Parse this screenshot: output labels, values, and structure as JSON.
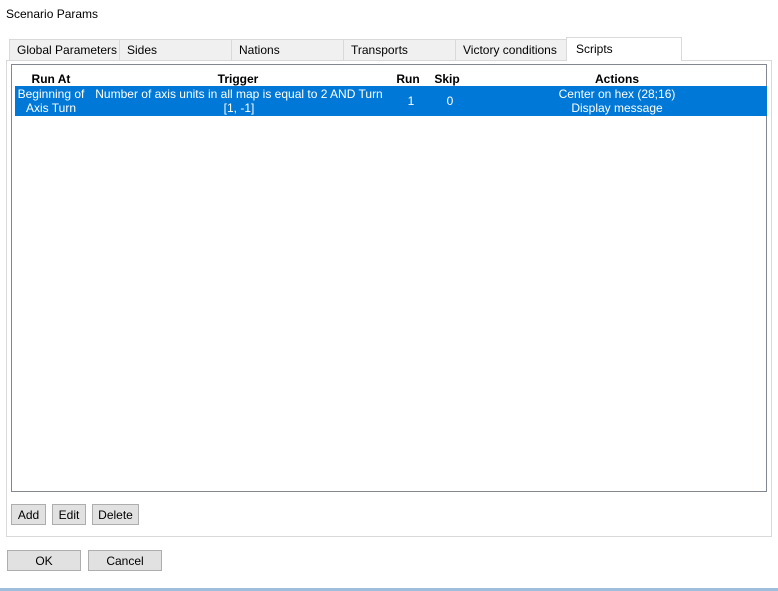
{
  "window": {
    "title": "Scenario Params"
  },
  "tabs": [
    {
      "label": "Global Parameters"
    },
    {
      "label": "Sides"
    },
    {
      "label": "Nations"
    },
    {
      "label": "Transports"
    },
    {
      "label": "Victory conditions"
    },
    {
      "label": "Scripts",
      "active": true
    }
  ],
  "table": {
    "columns": [
      "Run At",
      "Trigger",
      "Run",
      "Skip",
      "Actions"
    ],
    "rows": [
      {
        "run_at": [
          "Beginning of",
          "Axis Turn"
        ],
        "trigger": [
          "Number of axis units in all map is equal to 2 AND Turn",
          "[1, -1]"
        ],
        "run": "1",
        "skip": "0",
        "actions": [
          "Center on hex (28;16)",
          "Display message"
        ],
        "selected": true
      }
    ]
  },
  "panel_buttons": {
    "add": "Add",
    "edit": "Edit",
    "delete": "Delete"
  },
  "dialog_buttons": {
    "ok": "OK",
    "cancel": "Cancel"
  },
  "colors": {
    "selection": "#0078d7",
    "tab_bg": "#f0f0f0",
    "button_bg": "#e1e1e1"
  }
}
